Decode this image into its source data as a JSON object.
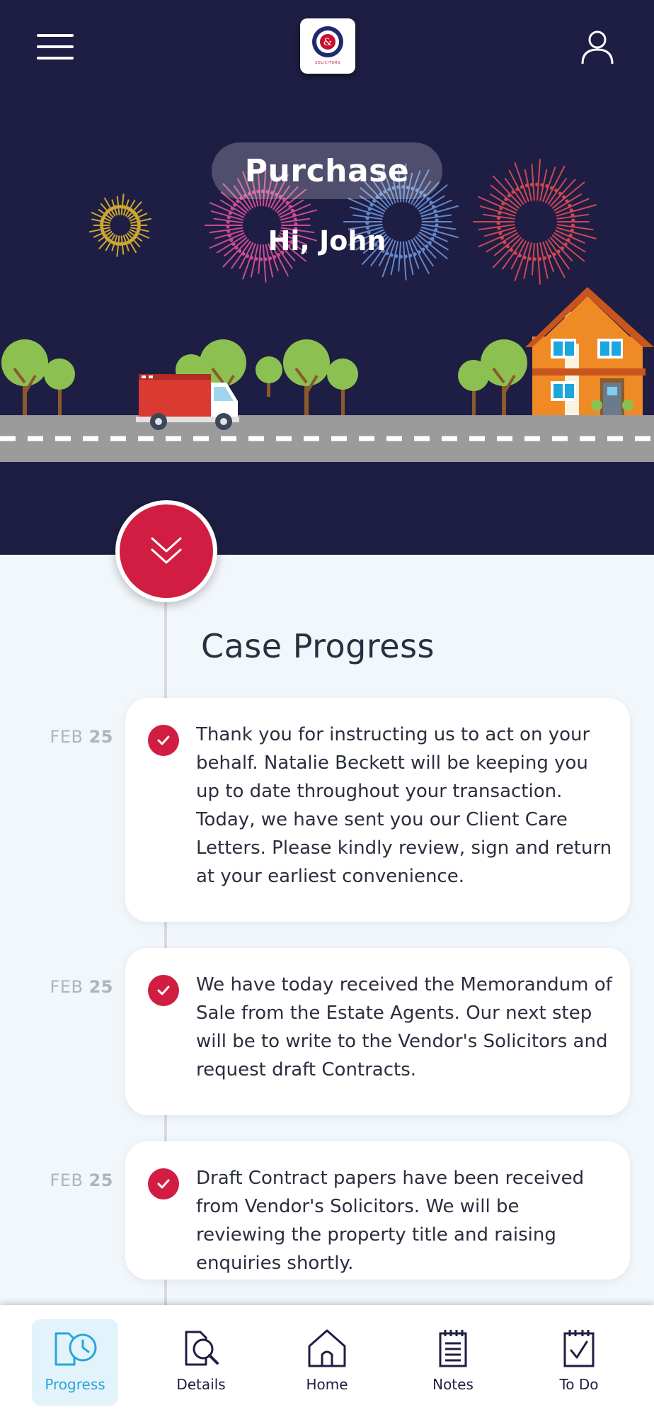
{
  "header": {
    "menu_icon": "hamburger-menu-icon",
    "logo_alt": "firm-logo",
    "logo_text": "SOLICITORS",
    "profile_icon": "user-profile-icon"
  },
  "hero": {
    "case_type": "Purchase",
    "greeting": "Hi, John"
  },
  "timeline": {
    "title": "Case Progress",
    "entries": [
      {
        "month": "FEB",
        "day": "25",
        "text": "Thank you for instructing us to act on your behalf.  Natalie Beckett will be keeping you up to date throughout your transaction.  Today, we have sent you our Client Care Letters.  Please kindly review, sign and return at your earliest convenience."
      },
      {
        "month": "FEB",
        "day": "25",
        "text": "We have today received the Memorandum of Sale from the Estate Agents.  Our next step will be to write to the Vendor's Solicitors and request draft Contracts."
      },
      {
        "month": "FEB",
        "day": "25",
        "text": "Draft Contract papers have been received from Vendor's Solicitors. We will be reviewing the property title and raising enquiries shortly."
      }
    ]
  },
  "nav": {
    "items": [
      {
        "label": "Progress",
        "icon": "progress-clock-icon",
        "active": true
      },
      {
        "label": "Details",
        "icon": "details-search-icon",
        "active": false
      },
      {
        "label": "Home",
        "icon": "home-icon",
        "active": false
      },
      {
        "label": "Notes",
        "icon": "notes-icon",
        "active": false
      },
      {
        "label": "To Do",
        "icon": "todo-checklist-icon",
        "active": false
      }
    ]
  },
  "colors": {
    "hero_bg": "#1e1e44",
    "accent": "#d21d43",
    "active_nav": "#2aa6d8",
    "active_nav_bg": "#e2f3fb",
    "page_bg": "#f2f7fb"
  }
}
